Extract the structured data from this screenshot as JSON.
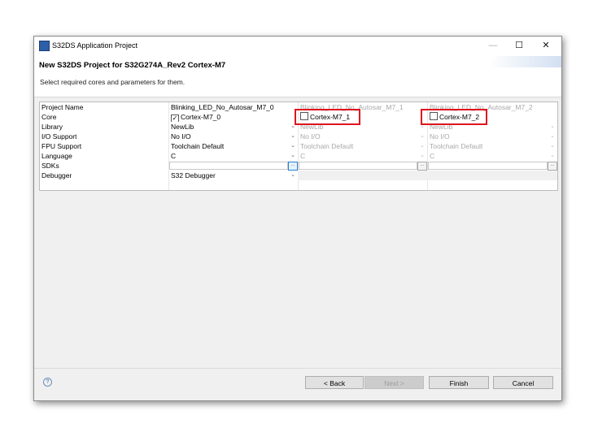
{
  "window": {
    "title": "S32DS Application Project",
    "minimize": "—",
    "maximize": "☐",
    "close": "✕"
  },
  "header": {
    "title": "New S32DS Project for S32G274A_Rev2 Cortex-M7",
    "description": "Select required cores and parameters for them."
  },
  "table": {
    "row_labels": [
      "Project Name",
      "Core",
      "Library",
      "I/O Support",
      "FPU Support",
      "Language",
      "SDKs",
      "Debugger"
    ],
    "columns": [
      {
        "project_name": "Blinking_LED_No_Autosar_M7_0",
        "core": "Cortex-M7_0",
        "core_checked": true,
        "enabled": true,
        "library": "NewLib",
        "io_support": "No I/O",
        "fpu_support": "Toolchain Default",
        "language": "C",
        "sdks": "",
        "debugger": "S32 Debugger"
      },
      {
        "project_name": "Blinking_LED_No_Autosar_M7_1",
        "core": "Cortex-M7_1",
        "core_checked": false,
        "enabled": false,
        "library": "NewLib",
        "io_support": "No I/O",
        "fpu_support": "Toolchain Default",
        "language": "C",
        "sdks": ""
      },
      {
        "project_name": "Blinking_LED_No_Autosar_M7_2",
        "core": "Cortex-M7_2",
        "core_checked": false,
        "enabled": false,
        "library": "NewLib",
        "io_support": "No I/O",
        "fpu_support": "Toolchain Default",
        "language": "C",
        "sdks": ""
      }
    ],
    "browse_label": "..."
  },
  "footer": {
    "help": "?",
    "back": "< Back",
    "next": "Next >",
    "finish": "Finish",
    "cancel": "Cancel"
  },
  "colors": {
    "highlight": "#e0141e"
  }
}
